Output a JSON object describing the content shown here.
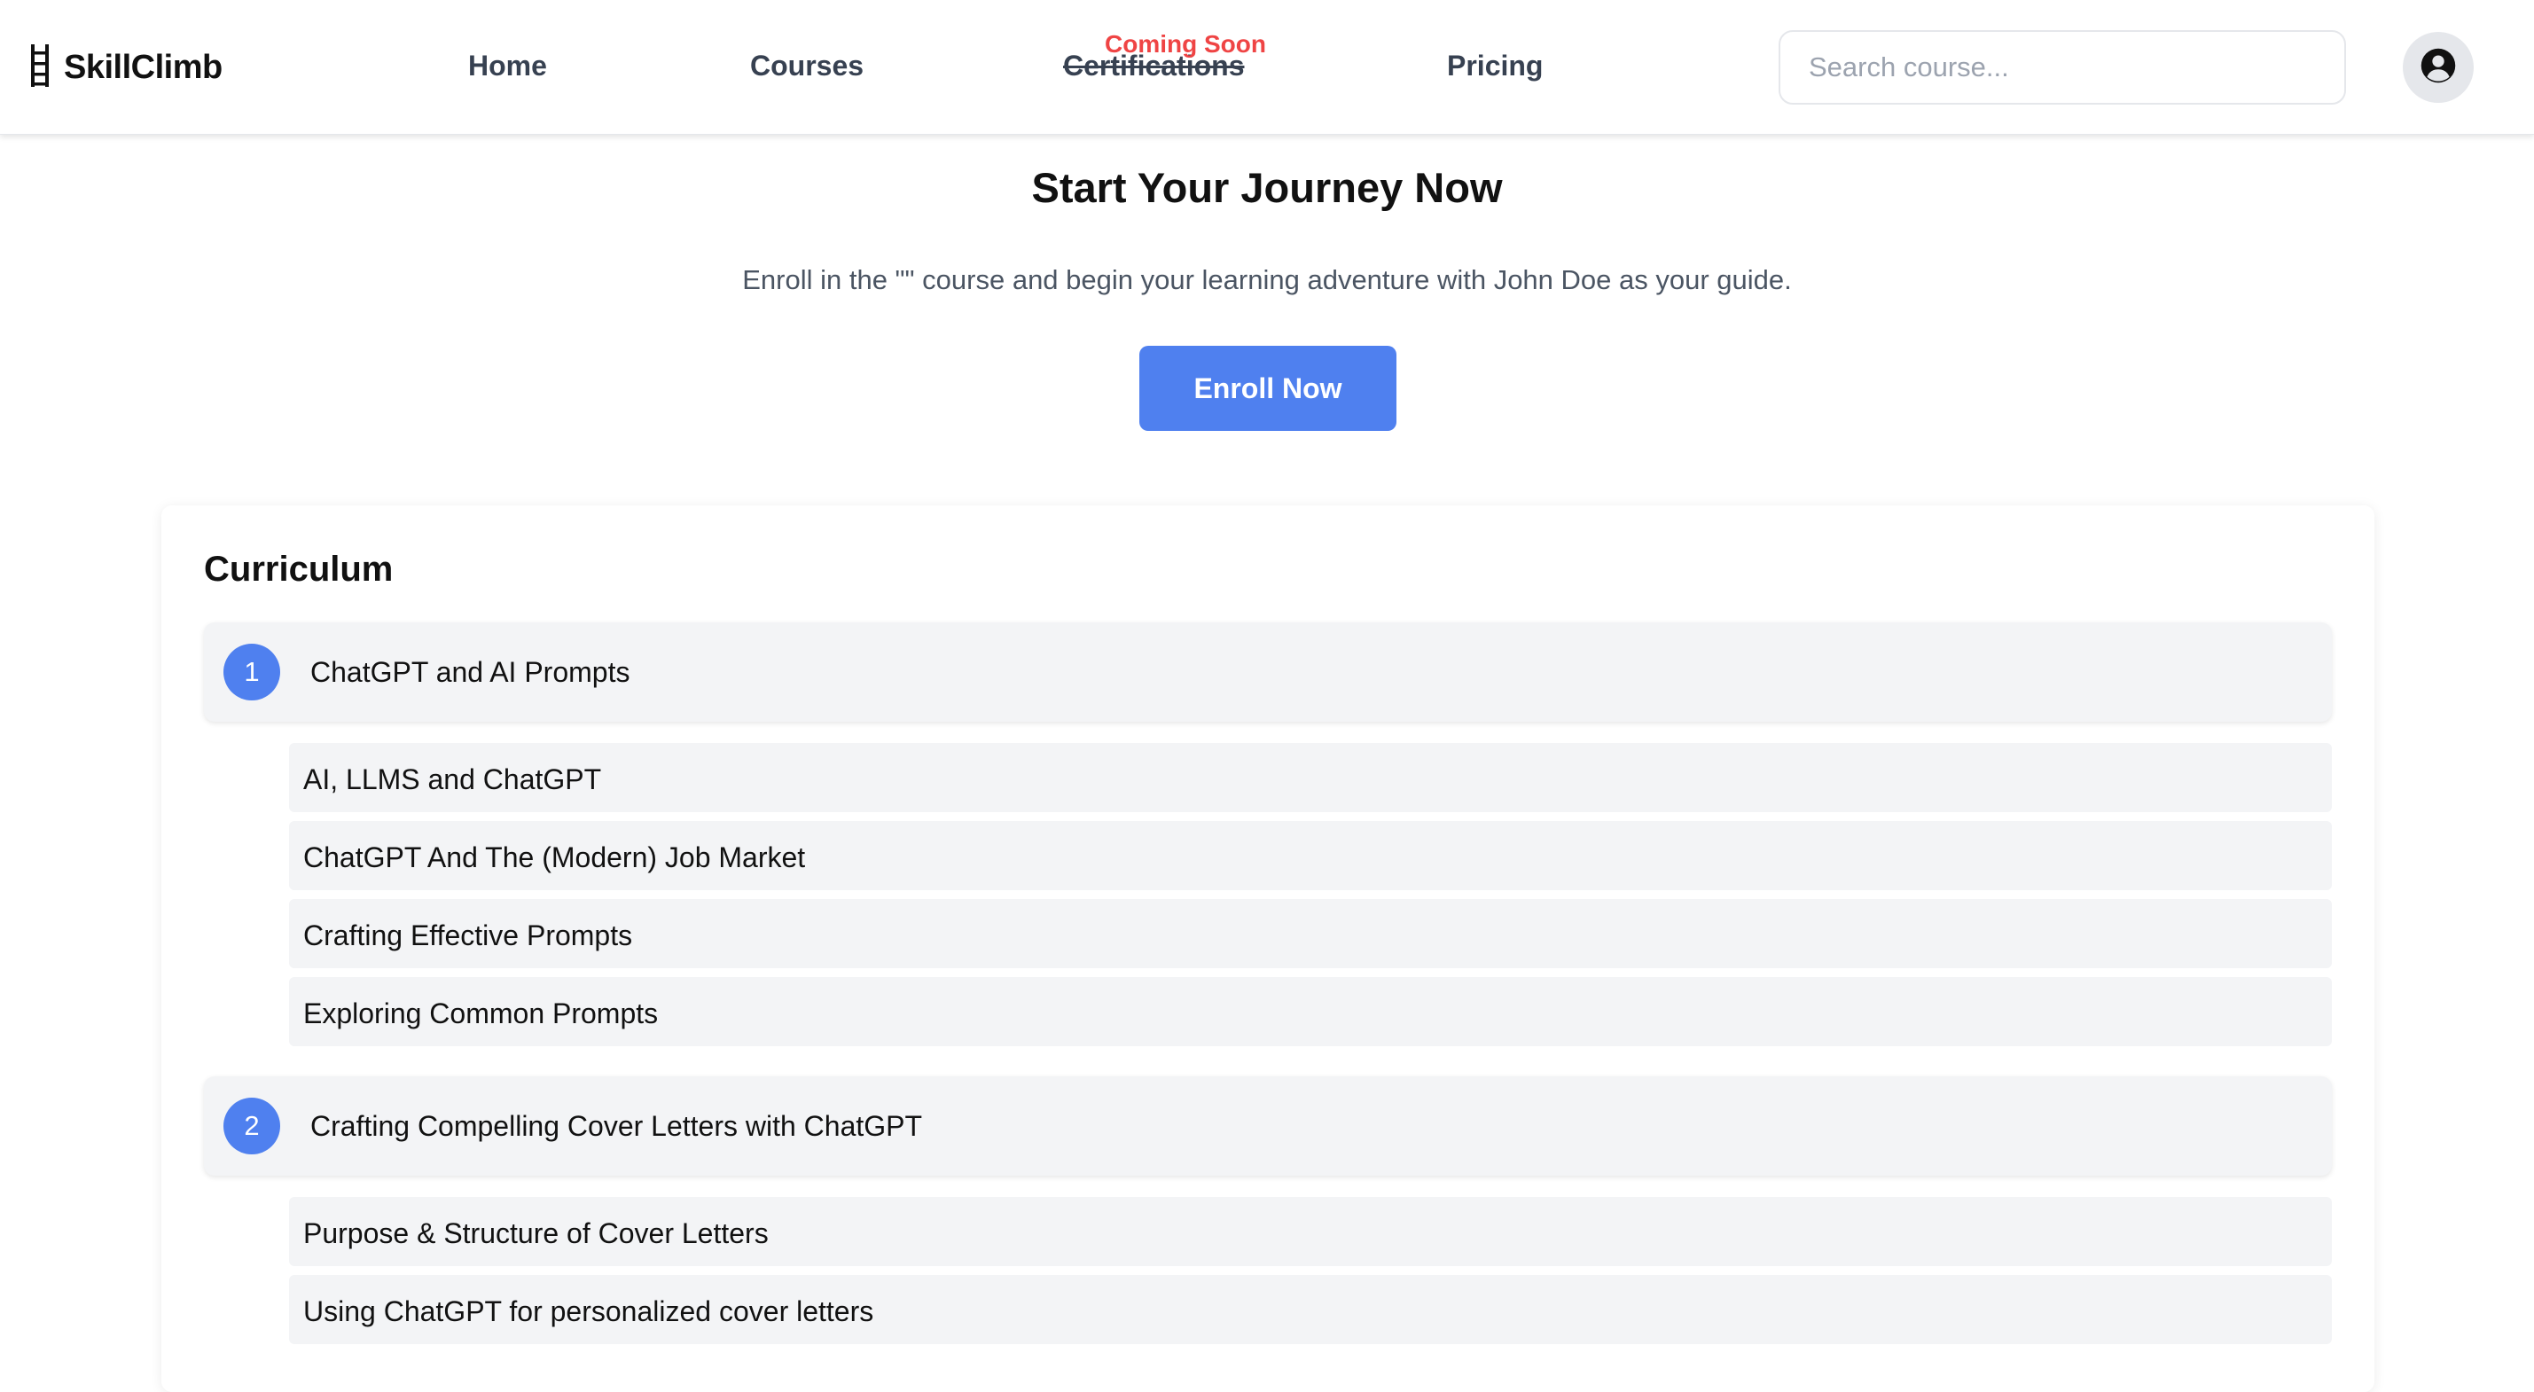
{
  "brand": {
    "name": "SkillClimb",
    "logo_icon": "ladder-icon"
  },
  "nav": {
    "home": "Home",
    "courses": "Courses",
    "certifications": "Certifications",
    "coming_soon": "Coming Soon",
    "pricing": "Pricing"
  },
  "search": {
    "placeholder": "Search course...",
    "value": ""
  },
  "user": {
    "icon": "user-circle-icon"
  },
  "hero": {
    "title": "Start Your Journey Now",
    "subtitle": "Enroll in the \"\" course and begin your learning adventure with John Doe as your guide.",
    "button": "Enroll Now"
  },
  "curriculum": {
    "title": "Curriculum",
    "modules": [
      {
        "number": "1",
        "title": "ChatGPT and AI Prompts",
        "lessons": [
          "AI, LLMS and ChatGPT",
          "ChatGPT And The (Modern) Job Market",
          "Crafting Effective Prompts",
          "Exploring Common Prompts"
        ]
      },
      {
        "number": "2",
        "title": "Crafting Compelling Cover Letters with ChatGPT",
        "lessons": [
          "Purpose & Structure of Cover Letters",
          "Using ChatGPT for personalized cover letters"
        ]
      }
    ]
  },
  "colors": {
    "accent": "#4f80ef",
    "coming_soon": "#ef4444",
    "row_background": "#f3f4f6"
  }
}
